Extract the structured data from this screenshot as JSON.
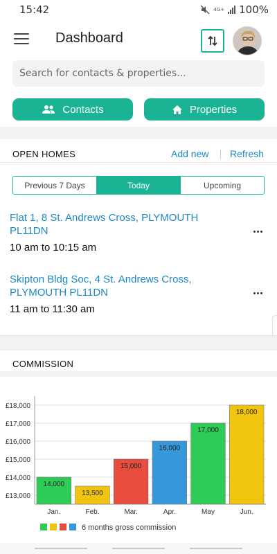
{
  "status_bar": {
    "time": "15:42",
    "network": "4G+",
    "battery": "100%",
    "icons": [
      "mute-icon",
      "signal-icon"
    ]
  },
  "header": {
    "title": "Dashboard",
    "icons": [
      "hamburger-menu-icon",
      "swap-vertical-icon",
      "avatar"
    ]
  },
  "search": {
    "placeholder": "Search for contacts & properties..."
  },
  "quick_actions": {
    "contacts_label": "Contacts",
    "properties_label": "Properties"
  },
  "colors": {
    "accent": "#1ab394",
    "link": "#1d87c6",
    "background_band": "#f2f2f2"
  },
  "open_homes": {
    "title": "OPEN HOMES",
    "add_new": "Add new",
    "refresh": "Refresh",
    "tabs": [
      {
        "label": "Previous 7 Days",
        "active": false
      },
      {
        "label": "Today",
        "active": true
      },
      {
        "label": "Upcoming",
        "active": false
      }
    ],
    "items": [
      {
        "address_line1": "Flat 1, 8 St. Andrews Cross, PLYMOUTH",
        "address_line2": "PL11DN",
        "time": "10 am to 10:15 am"
      },
      {
        "address_line1": "Skipton Bldg Soc, 4 St. Andrews Cross,",
        "address_line2": "PLYMOUTH PL11DN",
        "time": "11 am to 11:30 am"
      }
    ]
  },
  "commission": {
    "title": "COMMISSION"
  },
  "chart_data": {
    "type": "bar",
    "categories": [
      "Jan.",
      "Feb.",
      "Mar.",
      "Apr.",
      "May",
      "Jun."
    ],
    "values": [
      14000,
      13500,
      15000,
      16000,
      17000,
      18000
    ],
    "data_labels": [
      "14,000",
      "13,500",
      "15,000",
      "16,000",
      "17,000",
      "18,000"
    ],
    "colors": [
      "#2ecc57",
      "#f1c40f",
      "#e74c3c",
      "#3498db",
      "#2ecc57",
      "#f1c40f"
    ],
    "ylim": [
      12500,
      18500
    ],
    "yticks": [
      13000,
      14000,
      15000,
      16000,
      17000,
      18000
    ],
    "ytick_labels": [
      "£13,000",
      "£14,000",
      "£15,000",
      "£16,000",
      "£17,000",
      "£18,000"
    ],
    "legend": {
      "label": "6 months gross commission",
      "swatches": [
        "#2ecc57",
        "#f1c40f",
        "#e74c3c",
        "#3498db"
      ]
    },
    "grid": true,
    "legend_placement": "bottom"
  }
}
